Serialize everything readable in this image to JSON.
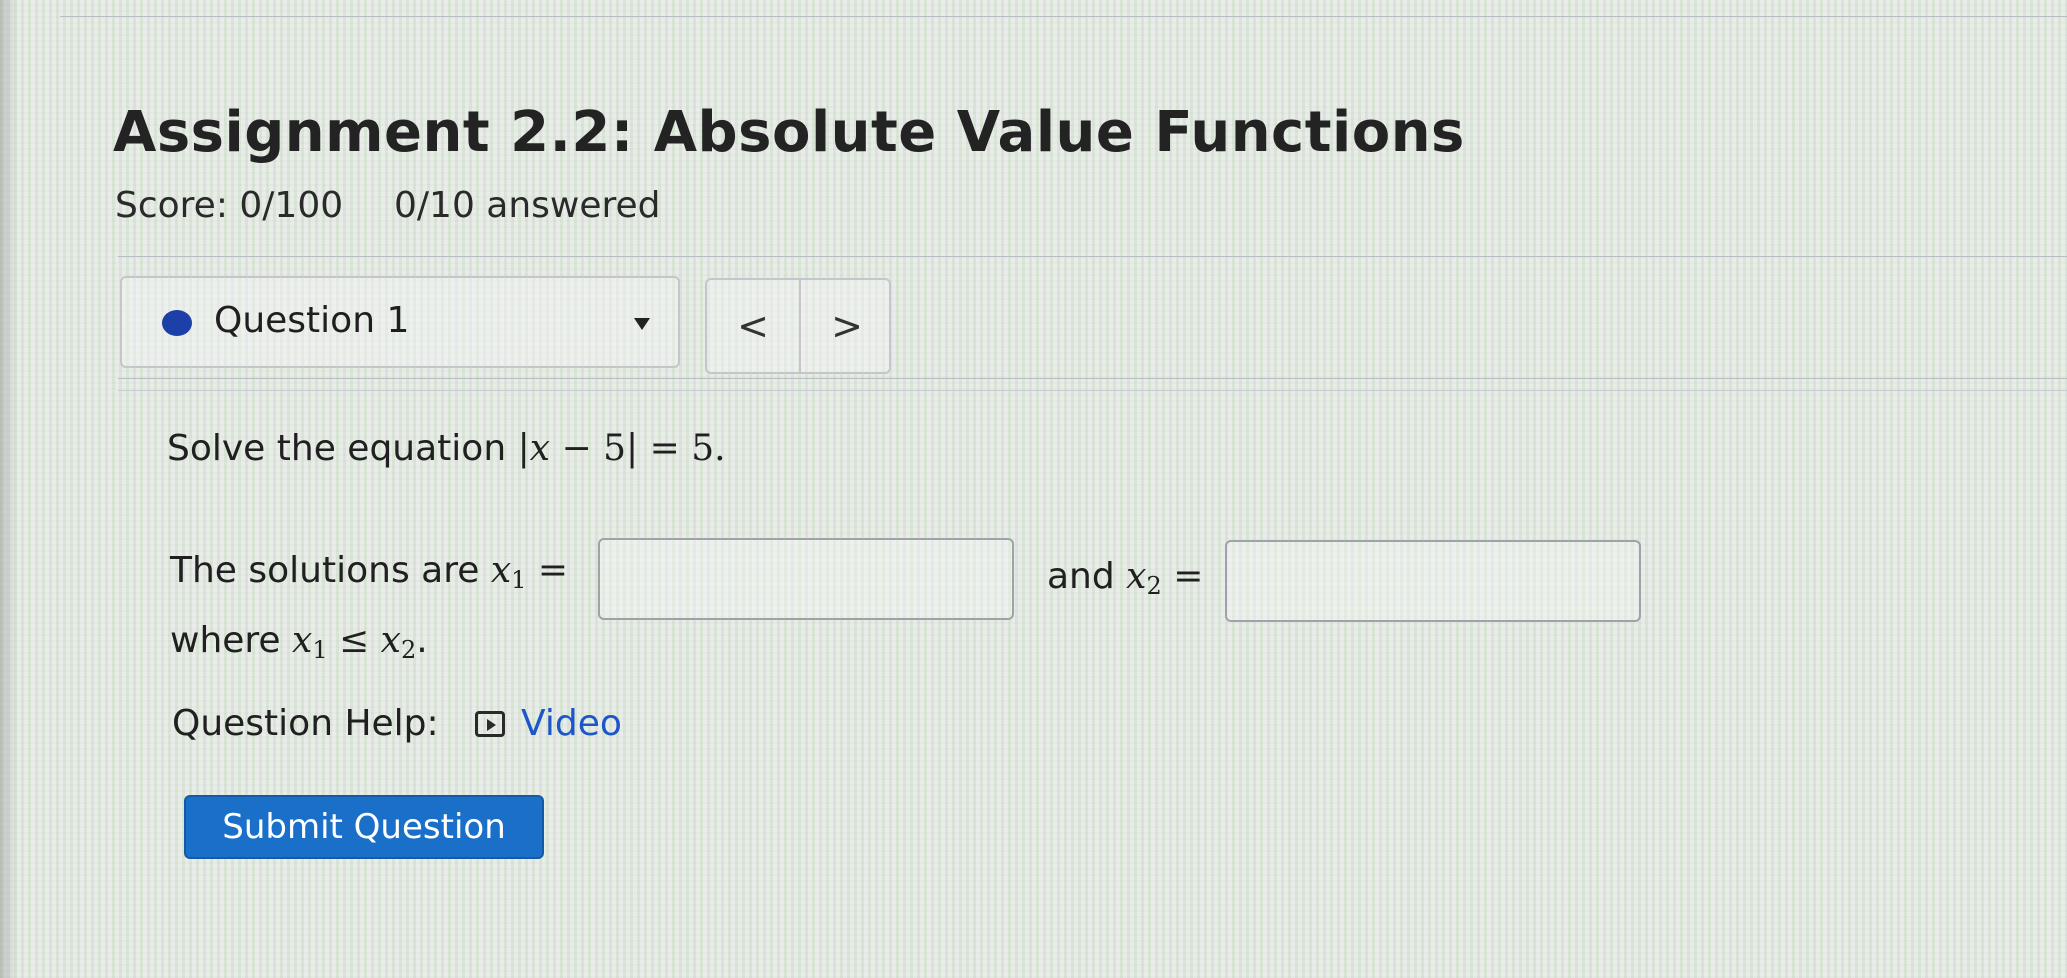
{
  "assignment": {
    "title": "Assignment 2.2: Absolute Value Functions",
    "score": "Score: 0/100",
    "answered": "0/10 answered"
  },
  "question_nav": {
    "selected_question": "Question 1",
    "prev_symbol": "<",
    "next_symbol": ">",
    "status_color": "#1c3fa8"
  },
  "question": {
    "prompt_prefix": "Solve the equation ",
    "equation": {
      "bar_left": "|",
      "variable": "x",
      "minus": " − 5",
      "bar_right": "|",
      "rhs": " = 5."
    },
    "solutions_prefix": "The solutions are ",
    "x1_var": "x",
    "x1_sub": "1",
    "equals": " =",
    "and_text": "and ",
    "x2_var": "x",
    "x2_sub": "2",
    "where_prefix": "where ",
    "leq": " ≤ ",
    "period": ".",
    "answer1_value": "",
    "answer2_value": ""
  },
  "help": {
    "label": "Question Help:",
    "video_label": "Video"
  },
  "actions": {
    "submit_label": "Submit Question",
    "submit_color": "#1a6fc8"
  }
}
